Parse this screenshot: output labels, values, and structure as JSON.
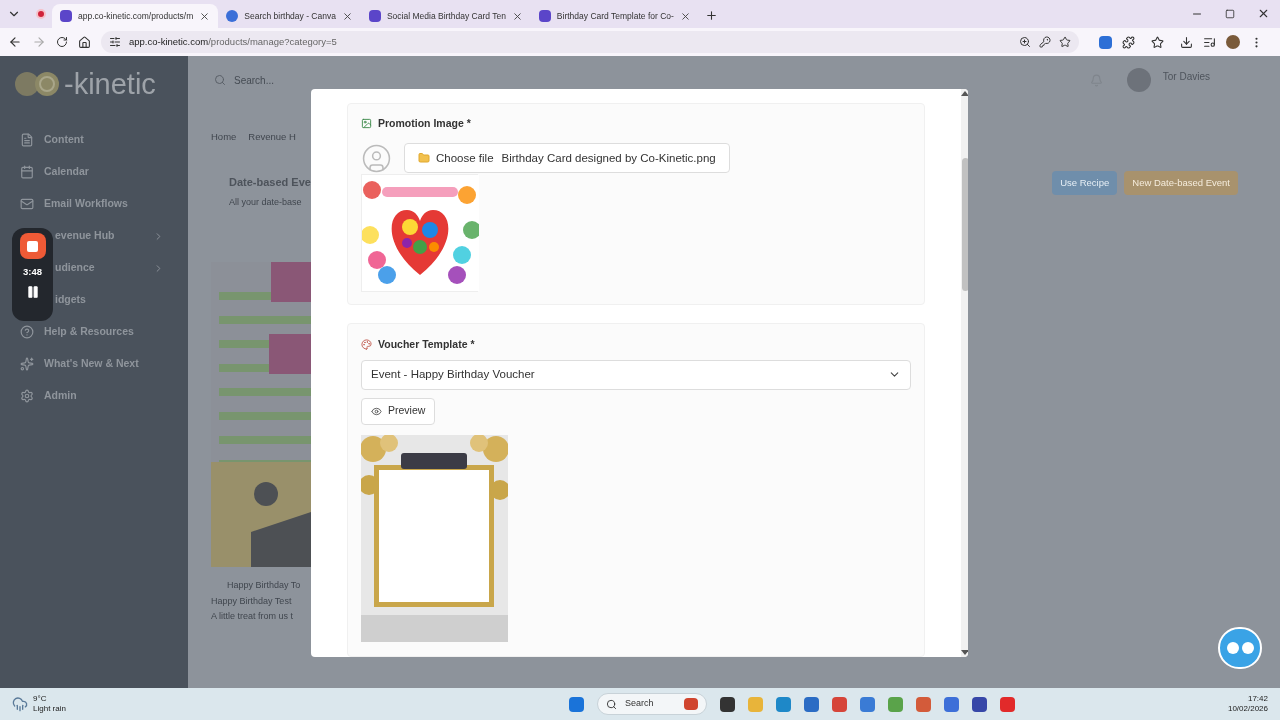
{
  "browser": {
    "tabs": [
      {
        "title": "app.co-kinetic.com/products/m",
        "selected": true
      },
      {
        "title": "Search birthday - Canva",
        "selected": false
      },
      {
        "title": "Social Media Birthday Card Ten",
        "selected": false
      },
      {
        "title": "Birthday Card Template for Co-",
        "selected": false
      }
    ],
    "url_host": "app.co-kinetic.com",
    "url_path": "/products/manage?category=5"
  },
  "recorder": {
    "time": "3:48"
  },
  "sidebar": {
    "logo": "-kinetic",
    "items": [
      {
        "label": "Content",
        "has_submenu": false
      },
      {
        "label": "Calendar",
        "has_submenu": false
      },
      {
        "label": "Email Workflows",
        "has_submenu": false
      },
      {
        "label": "evenue Hub",
        "has_submenu": true
      },
      {
        "label": "udience",
        "has_submenu": true
      },
      {
        "label": "idgets",
        "has_submenu": false
      },
      {
        "label": "Help & Resources",
        "has_submenu": false
      },
      {
        "label": "What's New & Next",
        "has_submenu": false
      },
      {
        "label": "Admin",
        "has_submenu": false
      }
    ]
  },
  "page": {
    "search_placeholder": "Search...",
    "user_name": "Tor Davies",
    "breadcrumbs": [
      "Home",
      "Revenue H"
    ],
    "heading": "Date-based Eve",
    "subheading": "All your date-base",
    "buttons": [
      "Use Recipe",
      "New Date-based Event"
    ],
    "card": {
      "title": "Happy Birthday To",
      "subtitle": "Happy Birthday Test",
      "description": "A little treat from us t"
    }
  },
  "modal": {
    "promotion": {
      "label": "Promotion Image *",
      "file_button": "Choose file",
      "file_name": "Birthday Card designed by Co-Kinetic.png"
    },
    "voucher": {
      "label": "Voucher Template *",
      "value": "Event - Happy Birthday Voucher",
      "preview_button": "Preview"
    }
  },
  "taskbar": {
    "temperature": "9°C",
    "weather": "Light rain",
    "search_placeholder": "Search",
    "time": "17:42",
    "date": "10/02/2026"
  }
}
